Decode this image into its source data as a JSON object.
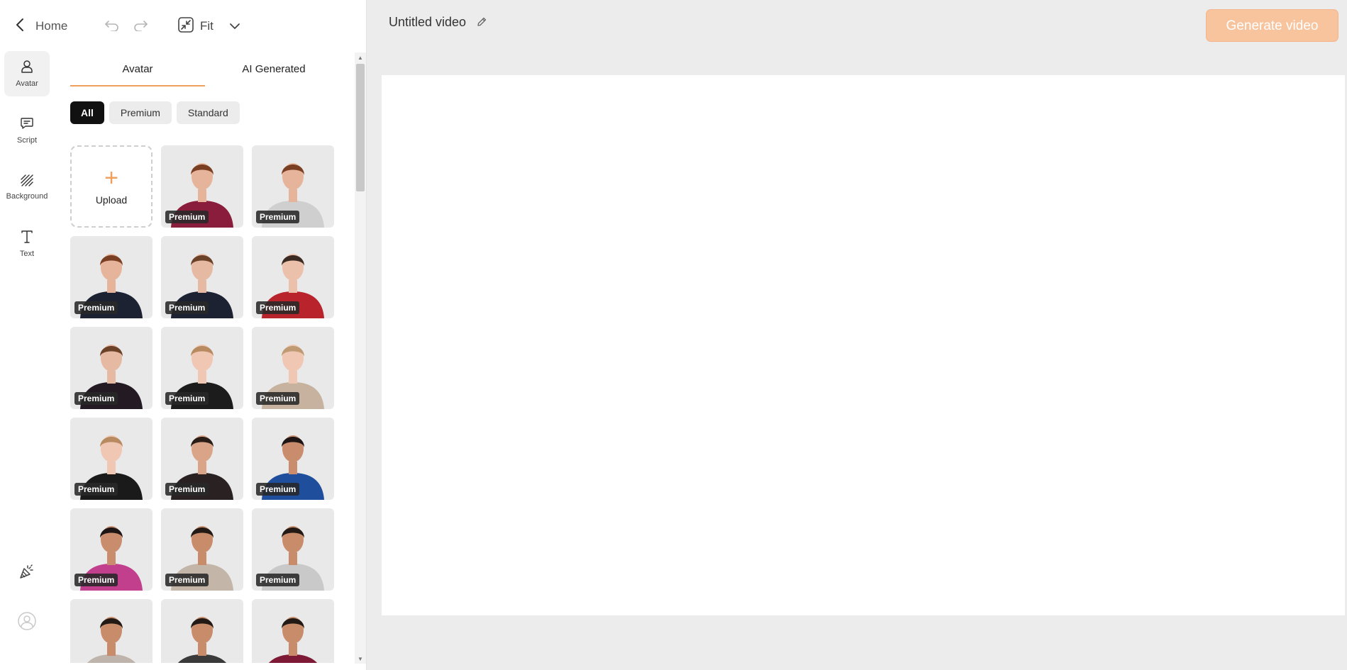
{
  "topbar": {
    "back_label": "Home",
    "fit_label": "Fit"
  },
  "rail": {
    "items": [
      {
        "label": "Avatar",
        "icon": "person-icon"
      },
      {
        "label": "Script",
        "icon": "chat-icon"
      },
      {
        "label": "Background",
        "icon": "hatch-icon"
      },
      {
        "label": "Text",
        "icon": "text-icon"
      }
    ]
  },
  "panel": {
    "tabs": [
      {
        "label": "Avatar"
      },
      {
        "label": "AI Generated"
      }
    ],
    "filters": [
      {
        "label": "All"
      },
      {
        "label": "Premium"
      },
      {
        "label": "Standard"
      }
    ],
    "upload_label": "Upload",
    "avatars": [
      {
        "badge": "Premium",
        "top": "#8a1d3b",
        "skin": "#e5b49a",
        "hair": "#7a3f22"
      },
      {
        "badge": "Premium",
        "top": "#cfcfcf",
        "skin": "#e5b49a",
        "hair": "#7a3f22"
      },
      {
        "badge": "Premium",
        "top": "#1d2233",
        "skin": "#e5b49a",
        "hair": "#7a3f22"
      },
      {
        "badge": "Premium",
        "top": "#1d2233",
        "skin": "#e6b9a2",
        "hair": "#6b4128"
      },
      {
        "badge": "Premium",
        "top": "#b8232c",
        "skin": "#ecc1ac",
        "hair": "#3a2a22"
      },
      {
        "badge": "Premium",
        "top": "#231a24",
        "skin": "#e6b9a2",
        "hair": "#6b4128"
      },
      {
        "badge": "Premium",
        "top": "#1c1c1c",
        "skin": "#efc7b2",
        "hair": "#b88a60"
      },
      {
        "badge": "Premium",
        "top": "#c6b29f",
        "skin": "#efc7b2",
        "hair": "#c09a72"
      },
      {
        "badge": "Premium",
        "top": "#1a1a1a",
        "skin": "#efc7b2",
        "hair": "#b88a60"
      },
      {
        "badge": "Premium",
        "top": "#2a2222",
        "skin": "#d9a487",
        "hair": "#2a1d18"
      },
      {
        "badge": "Premium",
        "top": "#1f4f9c",
        "skin": "#c98d6d",
        "hair": "#1e1614"
      },
      {
        "badge": "Premium",
        "top": "#c23f8e",
        "skin": "#c98d6d",
        "hair": "#1e1614"
      },
      {
        "badge": "Premium",
        "top": "#c3b5a8",
        "skin": "#c88c6b",
        "hair": "#241a15"
      },
      {
        "badge": "Premium",
        "top": "#c9c9c9",
        "skin": "#c88c6b",
        "hair": "#241a15"
      },
      {
        "badge": "",
        "top": "#bfb4ab",
        "skin": "#c88c6b",
        "hair": "#241a15"
      },
      {
        "badge": "",
        "top": "#3a3a3a",
        "skin": "#c88c6b",
        "hair": "#241a15"
      },
      {
        "badge": "",
        "top": "#7e1a35",
        "skin": "#c88c6b",
        "hair": "#241a15"
      }
    ]
  },
  "editor": {
    "title": "Untitled video",
    "generate_label": "Generate video"
  },
  "colors": {
    "accent": "#f0a05d",
    "generate_button": "#f7c49d",
    "chip_active": "#111111"
  }
}
